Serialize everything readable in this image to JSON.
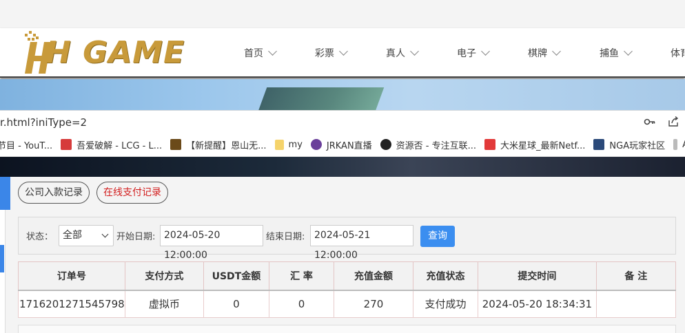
{
  "header": {
    "logo_text": "H GAME",
    "nav": [
      {
        "label": "首页"
      },
      {
        "label": "彩票"
      },
      {
        "label": "真人"
      },
      {
        "label": "电子"
      },
      {
        "label": "棋牌"
      },
      {
        "label": "捕鱼"
      },
      {
        "label": "体育"
      }
    ]
  },
  "browser": {
    "url_fragment": "r.html?iniType=2",
    "icons": [
      "key-icon",
      "share-icon"
    ],
    "bookmarks": [
      {
        "label": "节目 - YouT...",
        "icon": "youtube-icon",
        "color": "#ffffff"
      },
      {
        "label": "吾爱破解 - LCG - L...",
        "icon": "52pojie-icon",
        "color": "#d63b3b"
      },
      {
        "label": "【新提醒】恩山无...",
        "icon": "right-icon",
        "color": "#6b4a1a"
      },
      {
        "label": "my",
        "icon": "folder-icon",
        "color": "#f5d36b"
      },
      {
        "label": "JRKAN直播",
        "icon": "jrkan-icon",
        "color": "#6a3f9a"
      },
      {
        "label": "资源否 - 专注互联...",
        "icon": "globe-icon",
        "color": "#222222"
      },
      {
        "label": "大米星球_最新Netf...",
        "icon": "dami-icon",
        "color": "#e23a3a"
      },
      {
        "label": "NGA玩家社区",
        "icon": "nga-icon",
        "color": "#2b4a7a"
      },
      {
        "label": "AC",
        "icon": "ac-icon",
        "color": "#bbbbbb"
      }
    ]
  },
  "tabs": [
    {
      "label": "公司入款记录",
      "active": false
    },
    {
      "label": "在线支付记录",
      "active": true
    }
  ],
  "filter": {
    "status_label": "状态：",
    "status_value": "全部",
    "start_label": "开始日期:",
    "start_value": "2024-05-20 12:00:00",
    "end_label": "结束日期:",
    "end_value": "2024-05-21 12:00:00",
    "query_label": "查询"
  },
  "table": {
    "headers": [
      "订单号",
      "支付方式",
      "USDT金额",
      "汇 率",
      "充值金额",
      "充值状态",
      "提交时间",
      "备 注"
    ],
    "rows": [
      [
        "1716201271545798",
        "虚拟币",
        "0",
        "0",
        "270",
        "支付成功",
        "2024-05-20 18:34:31",
        ""
      ]
    ]
  },
  "colors": {
    "accent": "#3b8ef0",
    "active_tab": "#d21e1e",
    "logo_gold": "#c89a3a"
  }
}
